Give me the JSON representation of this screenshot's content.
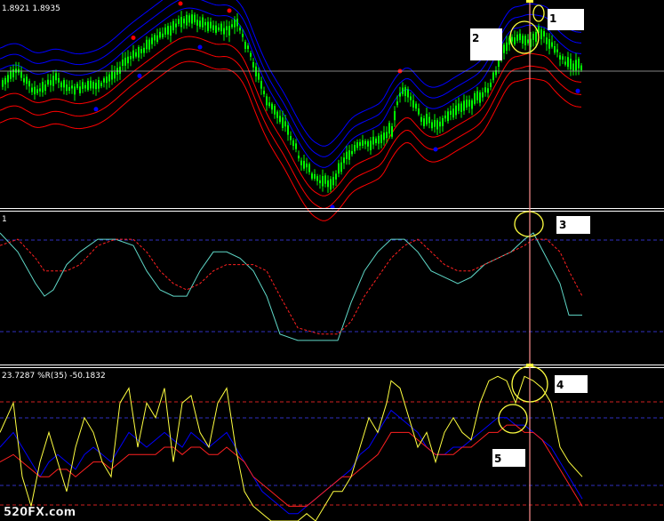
{
  "main_panel": {
    "header": "1.8921 1.8935",
    "callout_1": "1",
    "callout_2": "2"
  },
  "osc_panel": {
    "header": "1",
    "callout_3": "3"
  },
  "wpr_panel": {
    "header": "23.7287  %R(35) -50.1832",
    "callout_4": "4",
    "callout_5": "5"
  },
  "watermark": "520FX.com",
  "colors": {
    "background": "#000000",
    "candle_up": "#00ff00",
    "upper_band": "#0000ff",
    "lower_band": "#ff0000",
    "crosshair": "#ff9090",
    "osc_fast": "#5fd7c7",
    "osc_slow": "#ff2020",
    "wpr": "#ffff40",
    "wpr_red": "#ff2020",
    "wpr_blue": "#0000ff",
    "circle": "#ffff40",
    "label_box": "#ffffff"
  },
  "chart_data": [
    {
      "type": "line",
      "title": "1.8921 1.8935",
      "price_ctrl": [
        [
          0,
          95
        ],
        [
          20,
          80
        ],
        [
          40,
          105
        ],
        [
          60,
          88
        ],
        [
          80,
          100
        ],
        [
          100,
          98
        ],
        [
          120,
          90
        ],
        [
          140,
          70
        ],
        [
          160,
          55
        ],
        [
          180,
          40
        ],
        [
          200,
          25
        ],
        [
          215,
          20
        ],
        [
          235,
          30
        ],
        [
          255,
          35
        ],
        [
          265,
          25
        ],
        [
          280,
          60
        ],
        [
          300,
          115
        ],
        [
          320,
          140
        ],
        [
          340,
          185
        ],
        [
          360,
          205
        ],
        [
          375,
          205
        ],
        [
          385,
          180
        ],
        [
          400,
          165
        ],
        [
          420,
          160
        ],
        [
          440,
          145
        ],
        [
          450,
          100
        ],
        [
          460,
          110
        ],
        [
          475,
          135
        ],
        [
          490,
          140
        ],
        [
          510,
          125
        ],
        [
          530,
          115
        ],
        [
          550,
          100
        ],
        [
          565,
          55
        ],
        [
          575,
          45
        ],
        [
          585,
          40
        ],
        [
          595,
          50
        ],
        [
          605,
          35
        ],
        [
          615,
          45
        ],
        [
          625,
          55
        ],
        [
          635,
          72
        ],
        [
          655,
          75
        ]
      ],
      "signal_markers": [
        {
          "x": 150,
          "price": "high"
        },
        {
          "x": 203,
          "price": "high"
        },
        {
          "x": 258,
          "price": "high"
        },
        {
          "x": 450,
          "price": "high"
        },
        {
          "x": 108,
          "price": "low"
        },
        {
          "x": 157,
          "price": "low"
        },
        {
          "x": 225,
          "price": "low"
        },
        {
          "x": 374,
          "price": "low"
        },
        {
          "x": 490,
          "price": "low"
        },
        {
          "x": 650,
          "price": "low"
        }
      ]
    },
    {
      "type": "line",
      "title": "1",
      "x": [
        0,
        20,
        40,
        50,
        60,
        75,
        90,
        110,
        130,
        150,
        165,
        180,
        195,
        210,
        225,
        240,
        255,
        270,
        285,
        300,
        315,
        335,
        360,
        380,
        395,
        410,
        425,
        440,
        455,
        470,
        485,
        500,
        515,
        530,
        545,
        560,
        575,
        590,
        600,
        615,
        630,
        640,
        655
      ],
      "series": [
        {
          "values": [
            50,
            35,
            10,
            0,
            5,
            25,
            35,
            45,
            45,
            40,
            20,
            5,
            0,
            0,
            20,
            35,
            35,
            30,
            20,
            0,
            -30,
            -35,
            -35,
            -35,
            -5,
            20,
            35,
            45,
            45,
            35,
            20,
            15,
            10,
            15,
            25,
            30,
            35,
            45,
            50,
            30,
            10,
            -15,
            -15
          ]
        },
        {
          "values": [
            40,
            45,
            30,
            20,
            20,
            20,
            25,
            40,
            45,
            45,
            35,
            20,
            10,
            5,
            10,
            20,
            25,
            25,
            25,
            20,
            0,
            -25,
            -30,
            -30,
            -20,
            0,
            15,
            30,
            40,
            45,
            35,
            25,
            20,
            20,
            25,
            30,
            35,
            40,
            45,
            45,
            35,
            20,
            0
          ]
        }
      ]
    },
    {
      "type": "line",
      "title": "23.7287  %R(35) -50.1832",
      "x": [
        0,
        15,
        25,
        35,
        45,
        55,
        65,
        75,
        85,
        95,
        105,
        115,
        125,
        135,
        145,
        155,
        165,
        175,
        185,
        195,
        205,
        215,
        225,
        235,
        245,
        255,
        265,
        275,
        285,
        295,
        305,
        315,
        325,
        335,
        345,
        355,
        365,
        375,
        385,
        395,
        405,
        415,
        425,
        435,
        440,
        450,
        460,
        470,
        480,
        490,
        500,
        510,
        520,
        530,
        540,
        550,
        560,
        570,
        580,
        590,
        600,
        610,
        620,
        630,
        640,
        655
      ],
      "series": [
        {
          "values": [
            -40,
            -20,
            -70,
            -90,
            -60,
            -40,
            -60,
            -80,
            -50,
            -30,
            -40,
            -60,
            -70,
            -20,
            -10,
            -50,
            -20,
            -30,
            -10,
            -60,
            -20,
            -15,
            -40,
            -50,
            -20,
            -10,
            -50,
            -80,
            -90,
            -95,
            -100,
            -100,
            -100,
            -100,
            -95,
            -100,
            -90,
            -80,
            -80,
            -70,
            -50,
            -30,
            -40,
            -20,
            -5,
            -10,
            -30,
            -50,
            -40,
            -60,
            -40,
            -30,
            -40,
            -45,
            -20,
            -5,
            -2,
            -5,
            -20,
            -2,
            -5,
            -10,
            -20,
            -50,
            -60,
            -70
          ]
        },
        {
          "values": [
            -50,
            -40,
            -50,
            -60,
            -70,
            -60,
            -55,
            -60,
            -65,
            -55,
            -50,
            -55,
            -60,
            -50,
            -40,
            -45,
            -50,
            -45,
            -40,
            -45,
            -50,
            -40,
            -45,
            -50,
            -45,
            -40,
            -50,
            -60,
            -70,
            -80,
            -85,
            -90,
            -95,
            -95,
            -90,
            -85,
            -80,
            -75,
            -70,
            -65,
            -55,
            -50,
            -40,
            -30,
            -25,
            -30,
            -35,
            -40,
            -50,
            -55,
            -55,
            -50,
            -50,
            -45,
            -40,
            -35,
            -30,
            -30,
            -35,
            -35,
            -40,
            -45,
            -50,
            -60,
            -70,
            -85
          ]
        },
        {
          "values": [
            -60,
            -55,
            -60,
            -65,
            -70,
            -70,
            -65,
            -65,
            -70,
            -65,
            -60,
            -60,
            -65,
            -60,
            -55,
            -55,
            -55,
            -55,
            -50,
            -50,
            -55,
            -50,
            -50,
            -55,
            -55,
            -50,
            -55,
            -60,
            -70,
            -75,
            -80,
            -85,
            -90,
            -90,
            -90,
            -85,
            -80,
            -75,
            -70,
            -70,
            -65,
            -60,
            -55,
            -45,
            -40,
            -40,
            -40,
            -45,
            -50,
            -55,
            -55,
            -55,
            -50,
            -50,
            -45,
            -40,
            -40,
            -35,
            -35,
            -40,
            -40,
            -45,
            -55,
            -65,
            -75,
            -90
          ]
        }
      ]
    }
  ]
}
